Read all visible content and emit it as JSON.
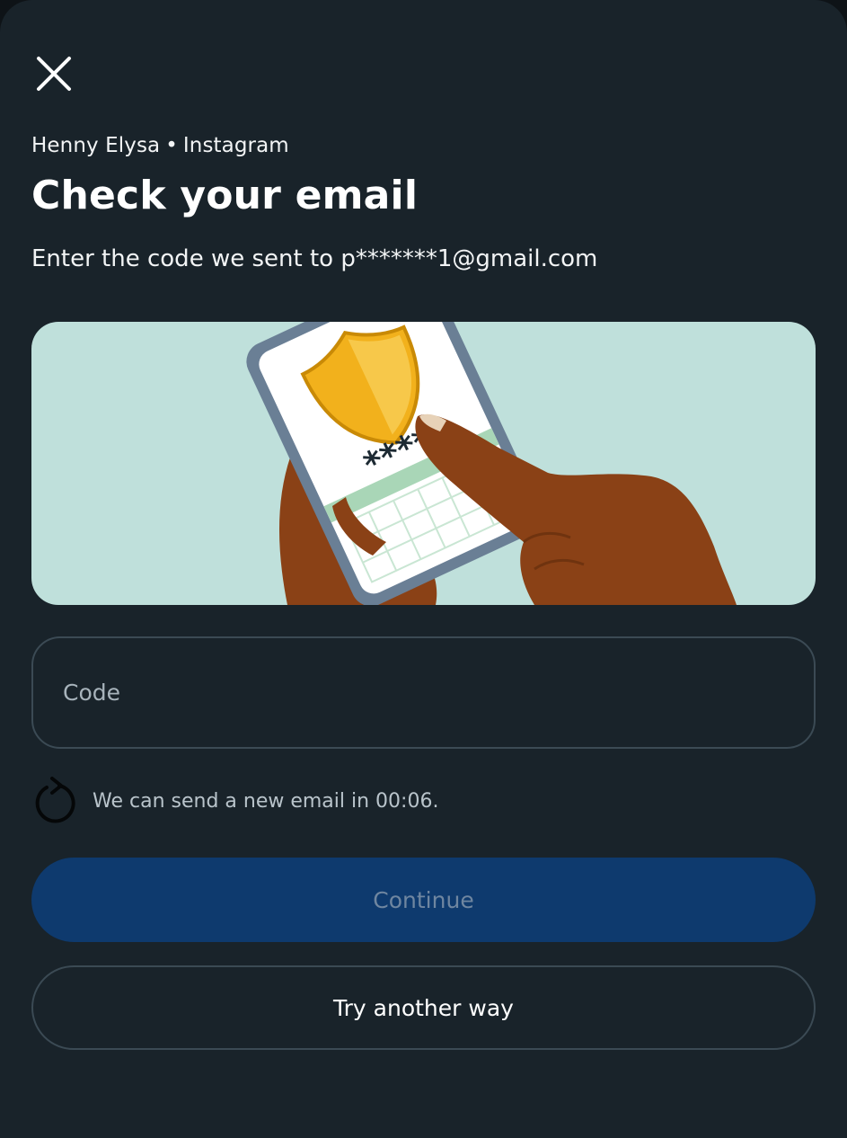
{
  "header": {
    "account_name": "Henny Elysa",
    "separator": "•",
    "app_name": "Instagram",
    "close_icon": "close-icon"
  },
  "main": {
    "title": "Check your email",
    "subtitle": "Enter the code we sent to p*******1@gmail.com",
    "illustration": {
      "masked_code": "****",
      "icon": "shield-icon"
    },
    "code_input": {
      "placeholder": "Code",
      "value": ""
    },
    "resend": {
      "icon": "refresh-icon",
      "text": "We can send a new email in 00:06."
    },
    "continue_button": "Continue",
    "another_way_button": "Try another way"
  },
  "colors": {
    "background": "#19232a",
    "illustration_bg": "#bfe0db",
    "continue_bg": "#0e3a6e",
    "border": "#3b4a54",
    "shield": "#f2b11c"
  }
}
